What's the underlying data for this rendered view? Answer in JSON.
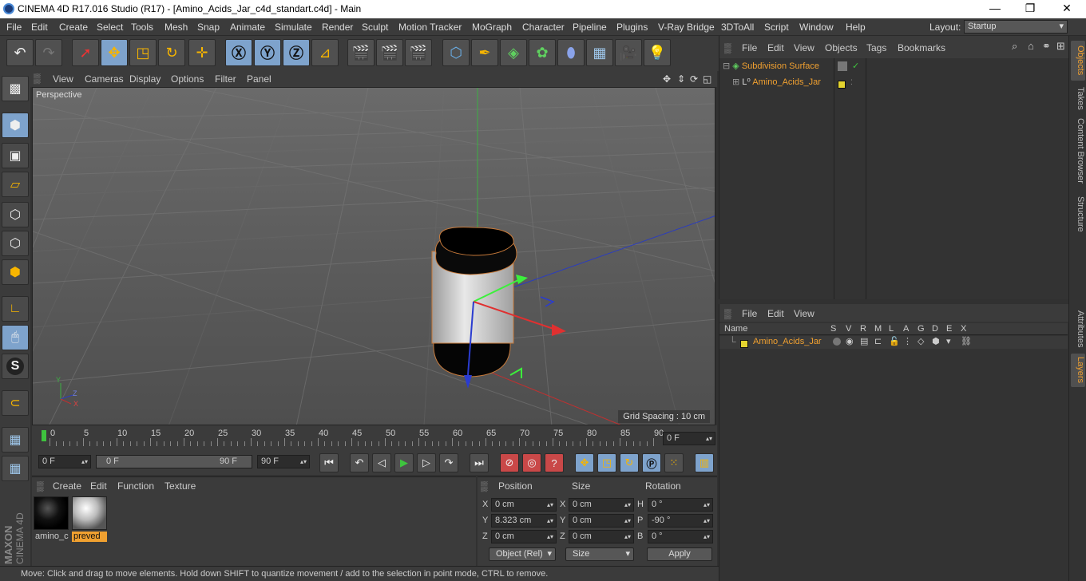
{
  "titlebar": {
    "title": "CINEMA 4D R17.016 Studio (R17) - [Amino_Acids_Jar_c4d_standart.c4d] - Main",
    "minimize": "—",
    "maximize": "❐",
    "close": "✕"
  },
  "menubar": {
    "items": [
      "File",
      "Edit",
      "Create",
      "Select",
      "Tools",
      "Mesh",
      "Snap",
      "Animate",
      "Simulate",
      "Render",
      "Sculpt",
      "Motion Tracker",
      "MoGraph",
      "Character",
      "Pipeline",
      "Plugins",
      "V-Ray Bridge",
      "3DToAll",
      "Script",
      "Window",
      "Help"
    ],
    "layout_label": "Layout:",
    "layout_value": "Startup"
  },
  "viewport": {
    "menu": [
      "View",
      "Cameras",
      "Display",
      "Options",
      "Filter",
      "Panel"
    ],
    "label": "Perspective",
    "grid_spacing": "Grid Spacing : 10 cm",
    "axis_y": "Y",
    "axis_x": "X",
    "axis_z": "Z"
  },
  "timeline": {
    "ticks": [
      "0",
      "5",
      "10",
      "15",
      "20",
      "25",
      "30",
      "35",
      "40",
      "45",
      "50",
      "55",
      "60",
      "65",
      "70",
      "75",
      "80",
      "85",
      "90"
    ],
    "current_frame": "0 F"
  },
  "transport": {
    "start": "0 F",
    "range_start": "0 F",
    "range_end": "90 F",
    "end": "90 F"
  },
  "materials": {
    "menu": [
      "Create",
      "Edit",
      "Function",
      "Texture"
    ],
    "items": [
      {
        "name": "amino_c"
      },
      {
        "name": "preved"
      }
    ]
  },
  "coords": {
    "headers": [
      "Position",
      "Size",
      "Rotation"
    ],
    "rows": [
      {
        "axis": "X",
        "pos": "0 cm",
        "size_axis": "X",
        "size": "0 cm",
        "rot_axis": "H",
        "rot": "0 °"
      },
      {
        "axis": "Y",
        "pos": "8.323 cm",
        "size_axis": "Y",
        "size": "0 cm",
        "rot_axis": "P",
        "rot": "-90 °"
      },
      {
        "axis": "Z",
        "pos": "0 cm",
        "size_axis": "Z",
        "size": "0 cm",
        "rot_axis": "B",
        "rot": "0 °"
      }
    ],
    "mode": "Object (Rel)",
    "size_mode": "Size",
    "apply": "Apply"
  },
  "statusbar": {
    "text": "Move: Click and drag to move elements. Hold down SHIFT to quantize movement / add to the selection in point mode, CTRL to remove."
  },
  "objects": {
    "menu": [
      "File",
      "Edit",
      "View",
      "Objects",
      "Tags",
      "Bookmarks"
    ],
    "items": [
      {
        "name": "Subdivision Surface"
      },
      {
        "name": "Amino_Acids_Jar"
      }
    ]
  },
  "layers": {
    "menu": [
      "File",
      "Edit",
      "View"
    ],
    "columns": [
      "Name",
      "S",
      "V",
      "R",
      "M",
      "L",
      "A",
      "G",
      "D",
      "E",
      "X"
    ],
    "items": [
      {
        "name": "Amino_Acids_Jar"
      }
    ]
  },
  "right_tabs": [
    "Objects",
    "Takes",
    "Content Browser",
    "Structure",
    "Attributes",
    "Layers"
  ],
  "brand": {
    "maxon": "MAXON",
    "cinema": "CINEMA 4D"
  },
  "colors": {
    "accent": "#7ea3cc",
    "highlight": "#f0a030",
    "layer": "#e3d32f"
  }
}
